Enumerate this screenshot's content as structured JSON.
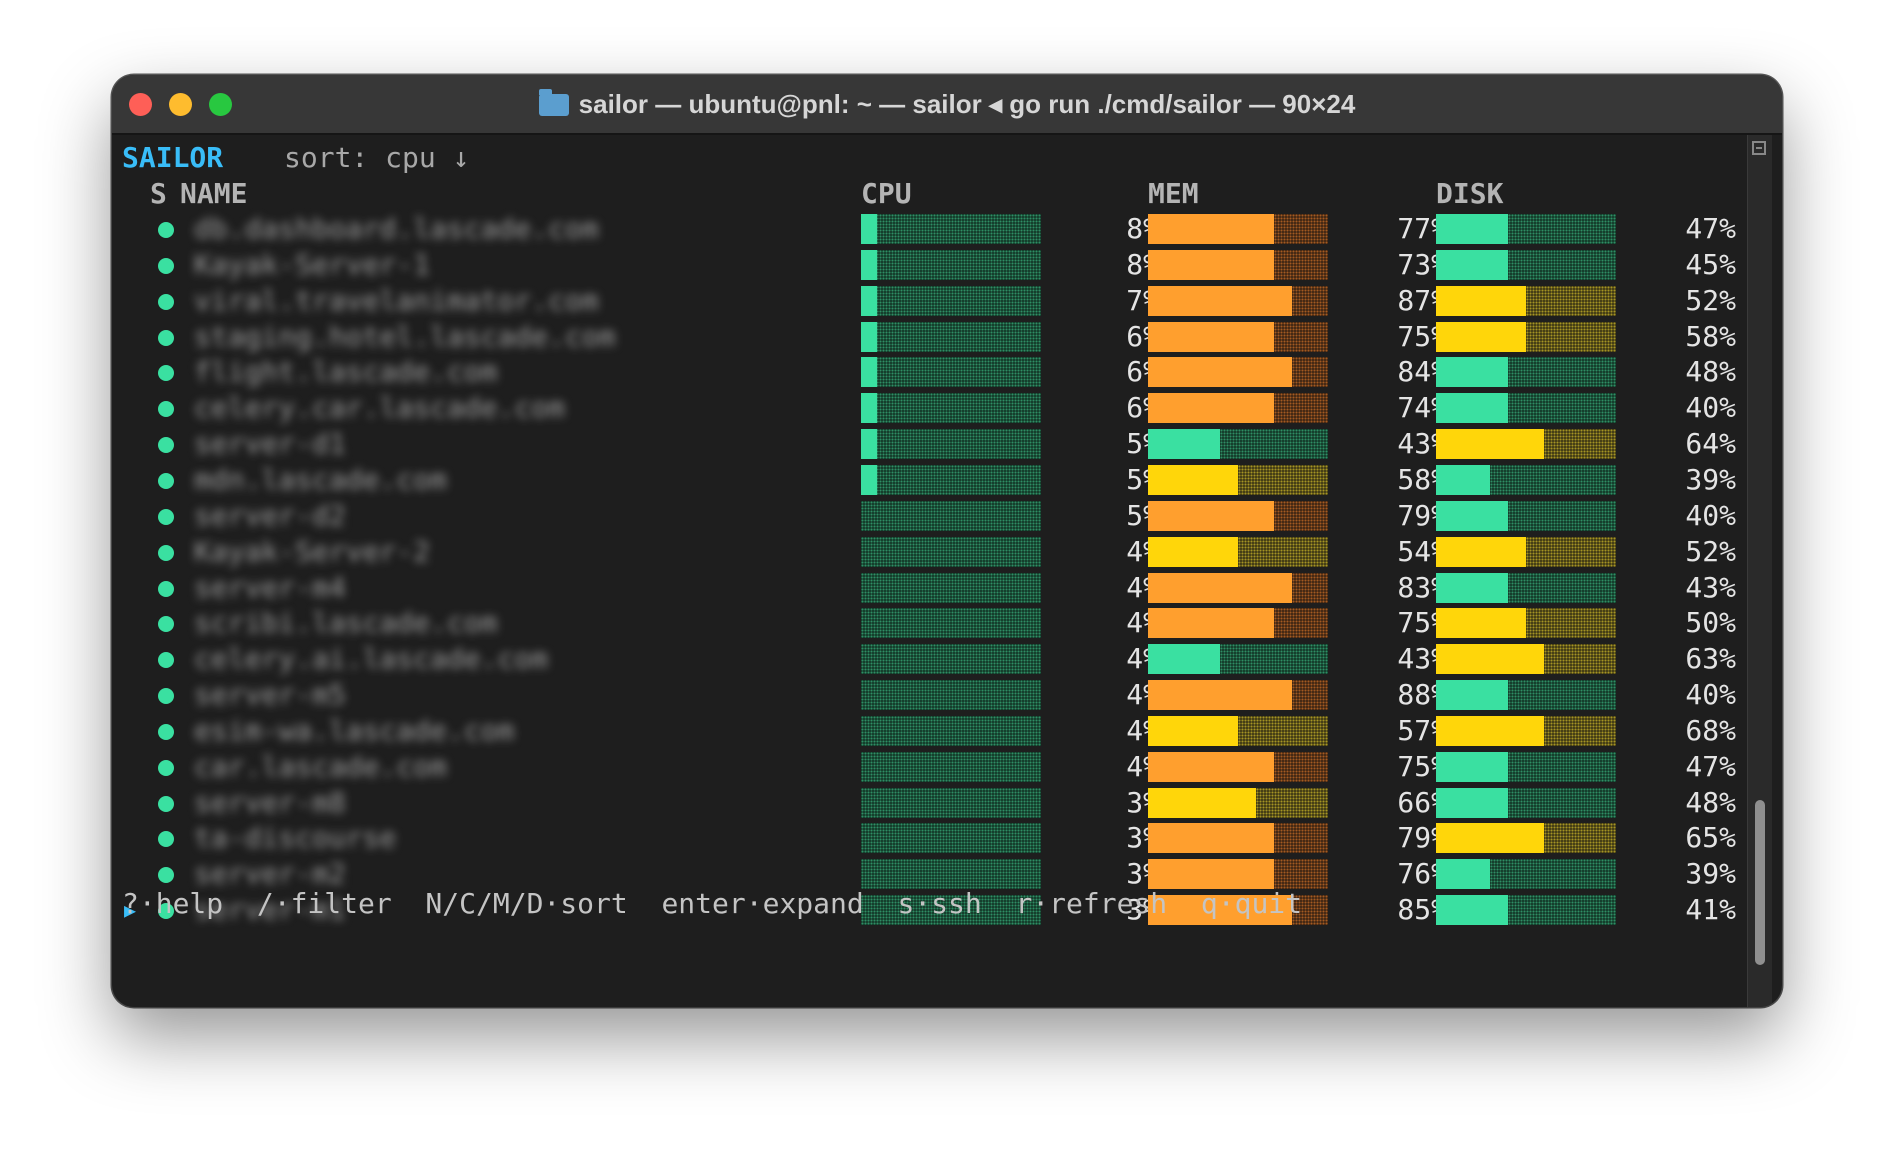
{
  "window": {
    "title": "sailor — ubuntu@pnl: ~ — sailor ◂ go run ./cmd/sailor — 90×24"
  },
  "app": {
    "name": "SAILOR",
    "sort_label": "sort: cpu ↓"
  },
  "columns": {
    "status": "S",
    "name": "NAME",
    "cpu": "CPU",
    "mem": "MEM",
    "disk": "DISK"
  },
  "colors": {
    "ok": "#3ae0a1",
    "warn": "#ffd60a",
    "high": "#ff9f2e",
    "accent": "#39bdf8"
  },
  "rows": [
    {
      "name": "db.dashboard.lascade.com",
      "cpu": "8%",
      "mem": "77%",
      "disk": "47%"
    },
    {
      "name": "Kayak-Server-1",
      "cpu": "8%",
      "mem": "73%",
      "disk": "45%"
    },
    {
      "name": "viral.travelanimator.com",
      "cpu": "7%",
      "mem": "87%",
      "disk": "52%"
    },
    {
      "name": "staging.hotel.lascade.com",
      "cpu": "6%",
      "mem": "75%",
      "disk": "58%"
    },
    {
      "name": "flight.lascade.com",
      "cpu": "6%",
      "mem": "84%",
      "disk": "48%"
    },
    {
      "name": "celery.car.lascade.com",
      "cpu": "6%",
      "mem": "74%",
      "disk": "40%"
    },
    {
      "name": "server-d1",
      "cpu": "5%",
      "mem": "43%",
      "disk": "64%"
    },
    {
      "name": "mdn.lascade.com",
      "cpu": "5%",
      "mem": "58%",
      "disk": "39%"
    },
    {
      "name": "server-d2",
      "cpu": "5%",
      "mem": "79%",
      "disk": "40%"
    },
    {
      "name": "Kayak-Server-2",
      "cpu": "4%",
      "mem": "54%",
      "disk": "52%"
    },
    {
      "name": "server-m4",
      "cpu": "4%",
      "mem": "83%",
      "disk": "43%"
    },
    {
      "name": "scribi.lascade.com",
      "cpu": "4%",
      "mem": "75%",
      "disk": "50%"
    },
    {
      "name": "celery.ai.lascade.com",
      "cpu": "4%",
      "mem": "43%",
      "disk": "63%"
    },
    {
      "name": "server-m5",
      "cpu": "4%",
      "mem": "88%",
      "disk": "40%"
    },
    {
      "name": "esim-wa.lascade.com",
      "cpu": "4%",
      "mem": "57%",
      "disk": "68%"
    },
    {
      "name": "car.lascade.com",
      "cpu": "4%",
      "mem": "75%",
      "disk": "47%"
    },
    {
      "name": "server-m8",
      "cpu": "3%",
      "mem": "66%",
      "disk": "48%"
    },
    {
      "name": "ta-discourse",
      "cpu": "3%",
      "mem": "79%",
      "disk": "65%"
    },
    {
      "name": "server-m2",
      "cpu": "3%",
      "mem": "76%",
      "disk": "39%"
    },
    {
      "name": "server-m1",
      "cpu": "3%",
      "mem": "85%",
      "disk": "41%",
      "selected": true
    }
  ],
  "footer": "?·help  /·filter  N/C/M/D·sort  enter·expand  s·ssh  r·refresh  q·quit"
}
